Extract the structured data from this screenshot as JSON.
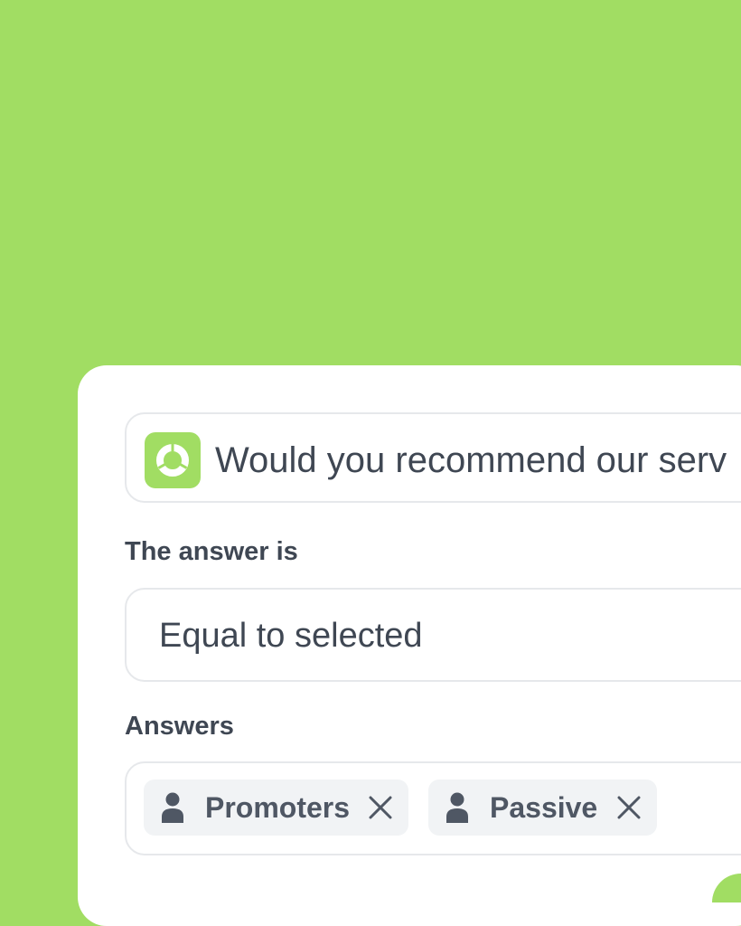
{
  "question": {
    "text": "Would you recommend our serv",
    "icon": "donut-chart-icon"
  },
  "condition": {
    "label": "The answer is",
    "value": "Equal to selected"
  },
  "answers": {
    "label": "Answers",
    "chips": [
      {
        "label": "Promoters",
        "icon": "user-icon"
      },
      {
        "label": "Passive",
        "icon": "user-icon"
      }
    ]
  },
  "colors": {
    "background": "#a1dd63",
    "card": "#ffffff",
    "text": "#3f4753",
    "border": "#e6e8eb",
    "chip_bg": "#f1f3f5"
  }
}
